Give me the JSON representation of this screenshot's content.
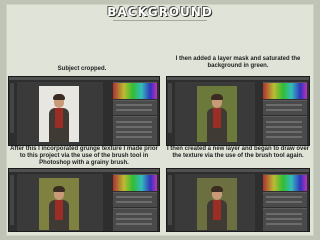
{
  "slide": {
    "title": "Background",
    "colors": {
      "background": "#bfc4b7",
      "panel": "#dfe3d8",
      "photoshop_ui": "#2e2e2e"
    }
  },
  "captions": {
    "top_left": "Subject cropped.",
    "top_right": "I then added a layer mask and saturated the background in green.",
    "bottom_left": "After this I incorporated grunge texture I made prior to this project via the use of the brush tool in Photoshop with a grainy brush.",
    "bottom_right": "I then created a new layer and began to draw over the texture via the use of the brush tool again."
  },
  "screenshots": [
    {
      "name": "subject-cropped",
      "canvas": "white"
    },
    {
      "name": "green-background",
      "canvas": "green"
    },
    {
      "name": "grunge-texture",
      "canvas": "grunge"
    },
    {
      "name": "drawn-texture",
      "canvas": "texture"
    }
  ]
}
